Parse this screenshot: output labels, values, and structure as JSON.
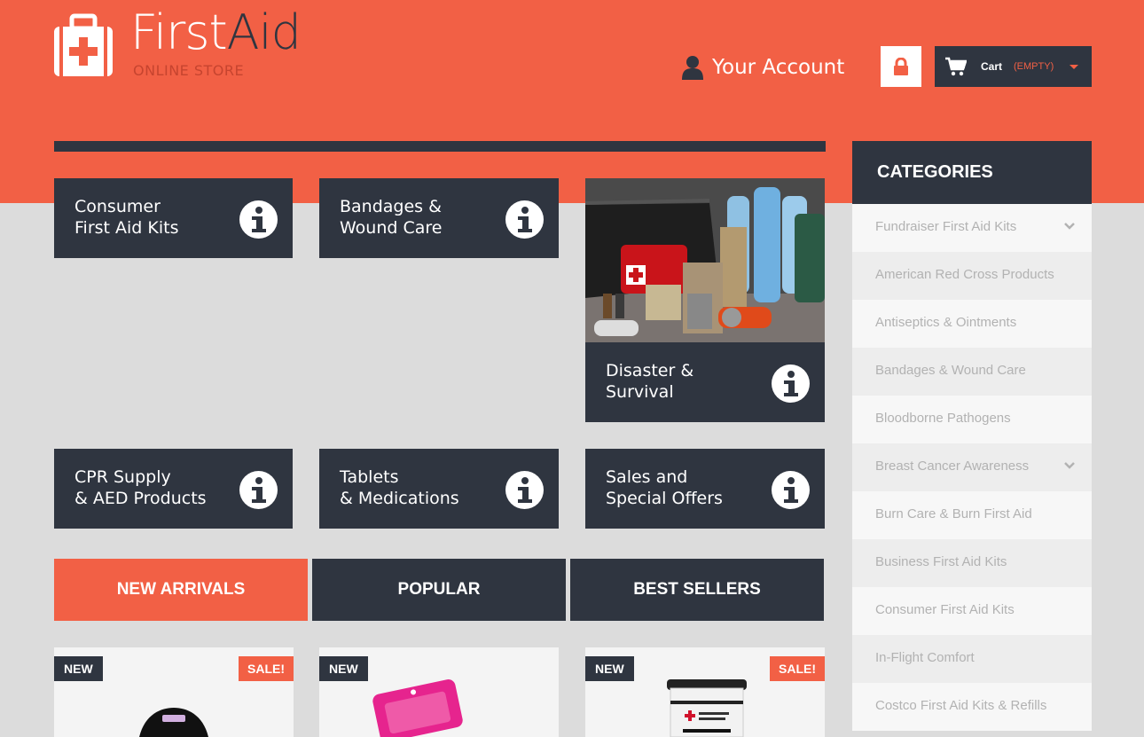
{
  "brand": {
    "title_first": "First",
    "title_second": "Aid",
    "subtitle": "ONLINE STORE"
  },
  "header": {
    "account_label": "Your Account",
    "cart_label": "Cart",
    "cart_status": "(EMPTY)"
  },
  "tiles": [
    {
      "label": "Consumer\nFirst Aid Kits"
    },
    {
      "label": "Bandages &\nWound Care"
    },
    {
      "label": "Disaster &\nSurvival"
    },
    {
      "label": "CPR Supply\n& AED Products"
    },
    {
      "label": "Tablets\n& Medications"
    },
    {
      "label": "Sales and\nSpecial Offers"
    }
  ],
  "tabs": [
    {
      "label": "NEW ARRIVALS",
      "active": true
    },
    {
      "label": "POPULAR",
      "active": false
    },
    {
      "label": "BEST SELLERS",
      "active": false
    }
  ],
  "products": [
    {
      "badge_new": "NEW",
      "badge_sale": "SALE!"
    },
    {
      "badge_new": "NEW",
      "badge_sale": ""
    },
    {
      "badge_new": "NEW",
      "badge_sale": "SALE!"
    }
  ],
  "categories": {
    "title": "CATEGORIES",
    "items": [
      {
        "label": "Fundraiser First Aid Kits",
        "has_children": true
      },
      {
        "label": "American Red Cross Products",
        "has_children": false
      },
      {
        "label": "Antiseptics & Ointments",
        "has_children": false
      },
      {
        "label": "Bandages & Wound Care",
        "has_children": false
      },
      {
        "label": "Bloodborne Pathogens",
        "has_children": false
      },
      {
        "label": "Breast Cancer Awareness",
        "has_children": true
      },
      {
        "label": "Burn Care & Burn First Aid",
        "has_children": false
      },
      {
        "label": "Business First Aid Kits",
        "has_children": false
      },
      {
        "label": "Consumer First Aid Kits",
        "has_children": false
      },
      {
        "label": "In-Flight Comfort",
        "has_children": false
      },
      {
        "label": "Costco First Aid Kits & Refills",
        "has_children": false
      }
    ]
  },
  "colors": {
    "accent": "#f26045",
    "dark": "#2f3540",
    "background": "#dcdcdc"
  }
}
